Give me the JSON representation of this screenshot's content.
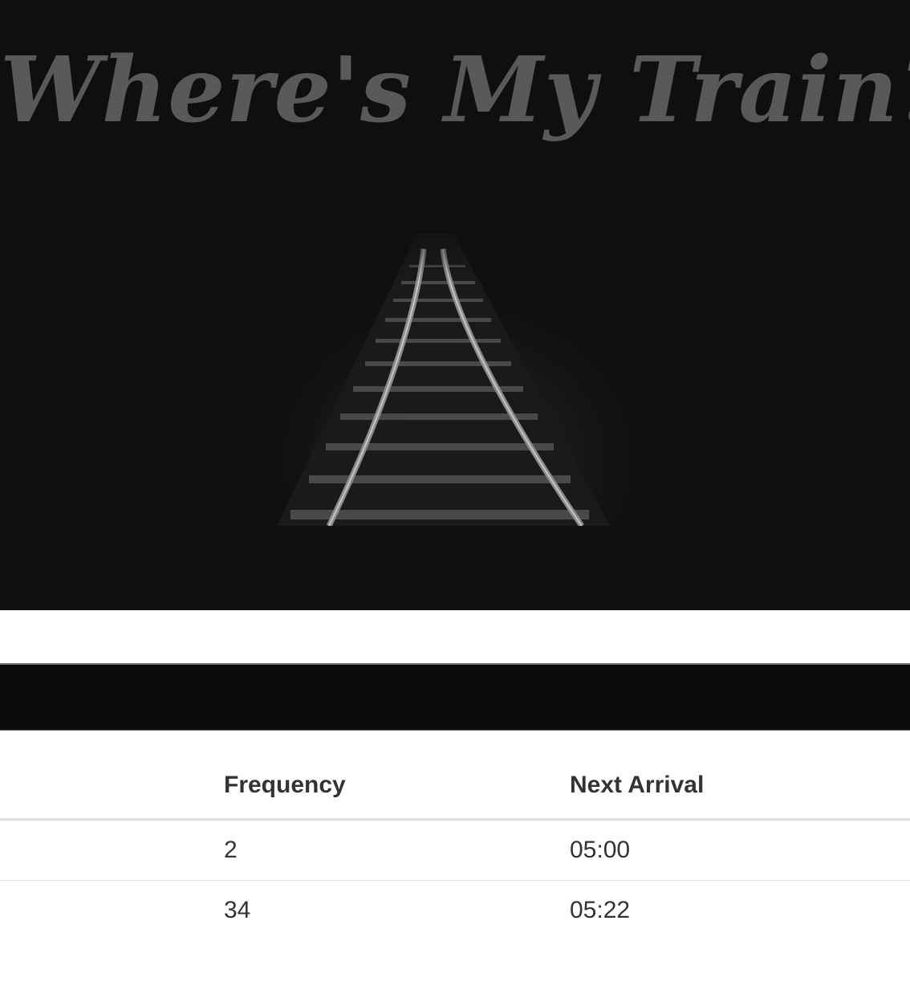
{
  "hero": {
    "title": "Where's My Train?",
    "background_color": "#0f0f0f",
    "title_color": "#595959",
    "image_icon": "railroad-tracks-image"
  },
  "schedule": {
    "columns": [
      "",
      "Frequency",
      "Next Arrival"
    ],
    "rows": [
      {
        "frequency": "2",
        "next_arrival": "05:00"
      },
      {
        "frequency": "34",
        "next_arrival": "05:22"
      }
    ]
  }
}
